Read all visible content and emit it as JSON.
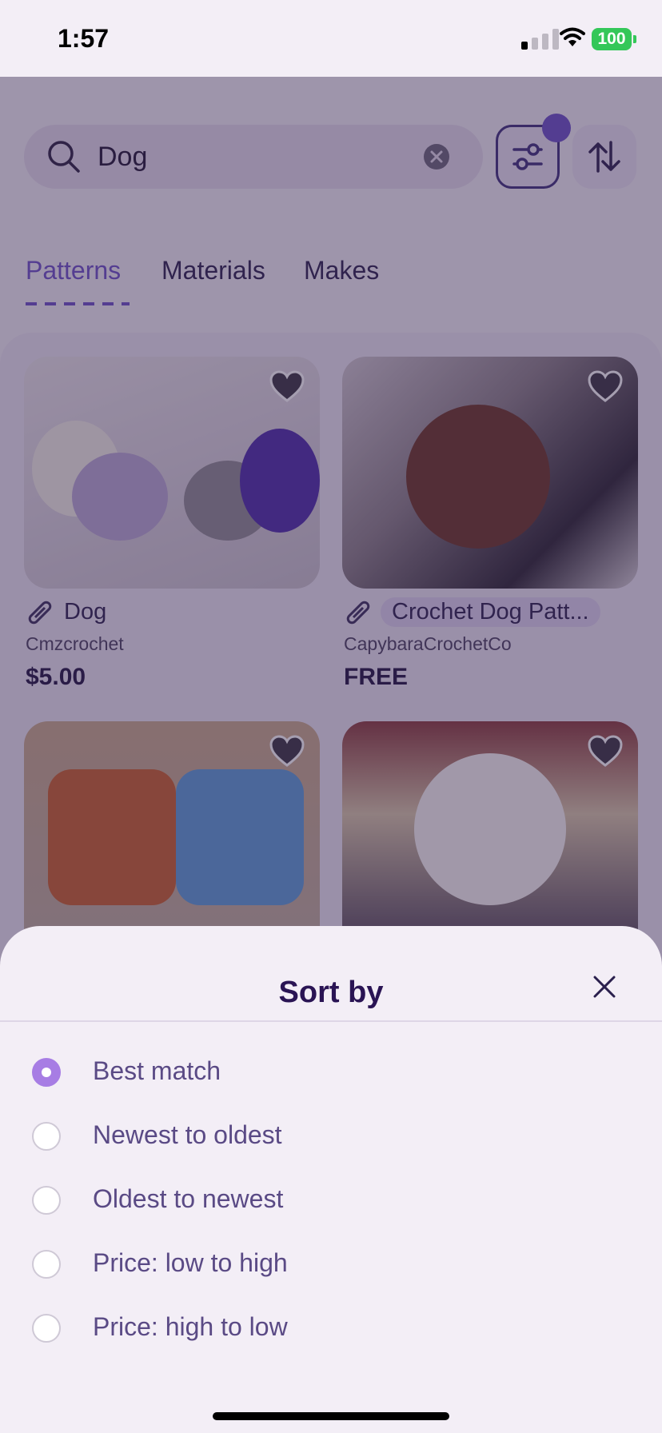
{
  "status_bar": {
    "time": "1:57",
    "battery": "100"
  },
  "search": {
    "query": "Dog"
  },
  "tabs": [
    {
      "label": "Patterns",
      "active": true
    },
    {
      "label": "Materials",
      "active": false
    },
    {
      "label": "Makes",
      "active": false
    }
  ],
  "items": [
    {
      "title": "Dog",
      "shop": "Cmzcrochet",
      "price": "$5.00"
    },
    {
      "title": "Crochet Dog Patt...",
      "shop": "CapybaraCrochetCo",
      "price": "FREE"
    }
  ],
  "sort_sheet": {
    "title": "Sort by",
    "options": [
      {
        "label": "Best match",
        "selected": true
      },
      {
        "label": "Newest to oldest",
        "selected": false
      },
      {
        "label": "Oldest to newest",
        "selected": false
      },
      {
        "label": "Price: low to high",
        "selected": false
      },
      {
        "label": "Price: high to low",
        "selected": false
      }
    ]
  },
  "colors": {
    "accent": "#6c4fc7",
    "radio_selected": "#a77de4",
    "battery": "#34c759"
  }
}
